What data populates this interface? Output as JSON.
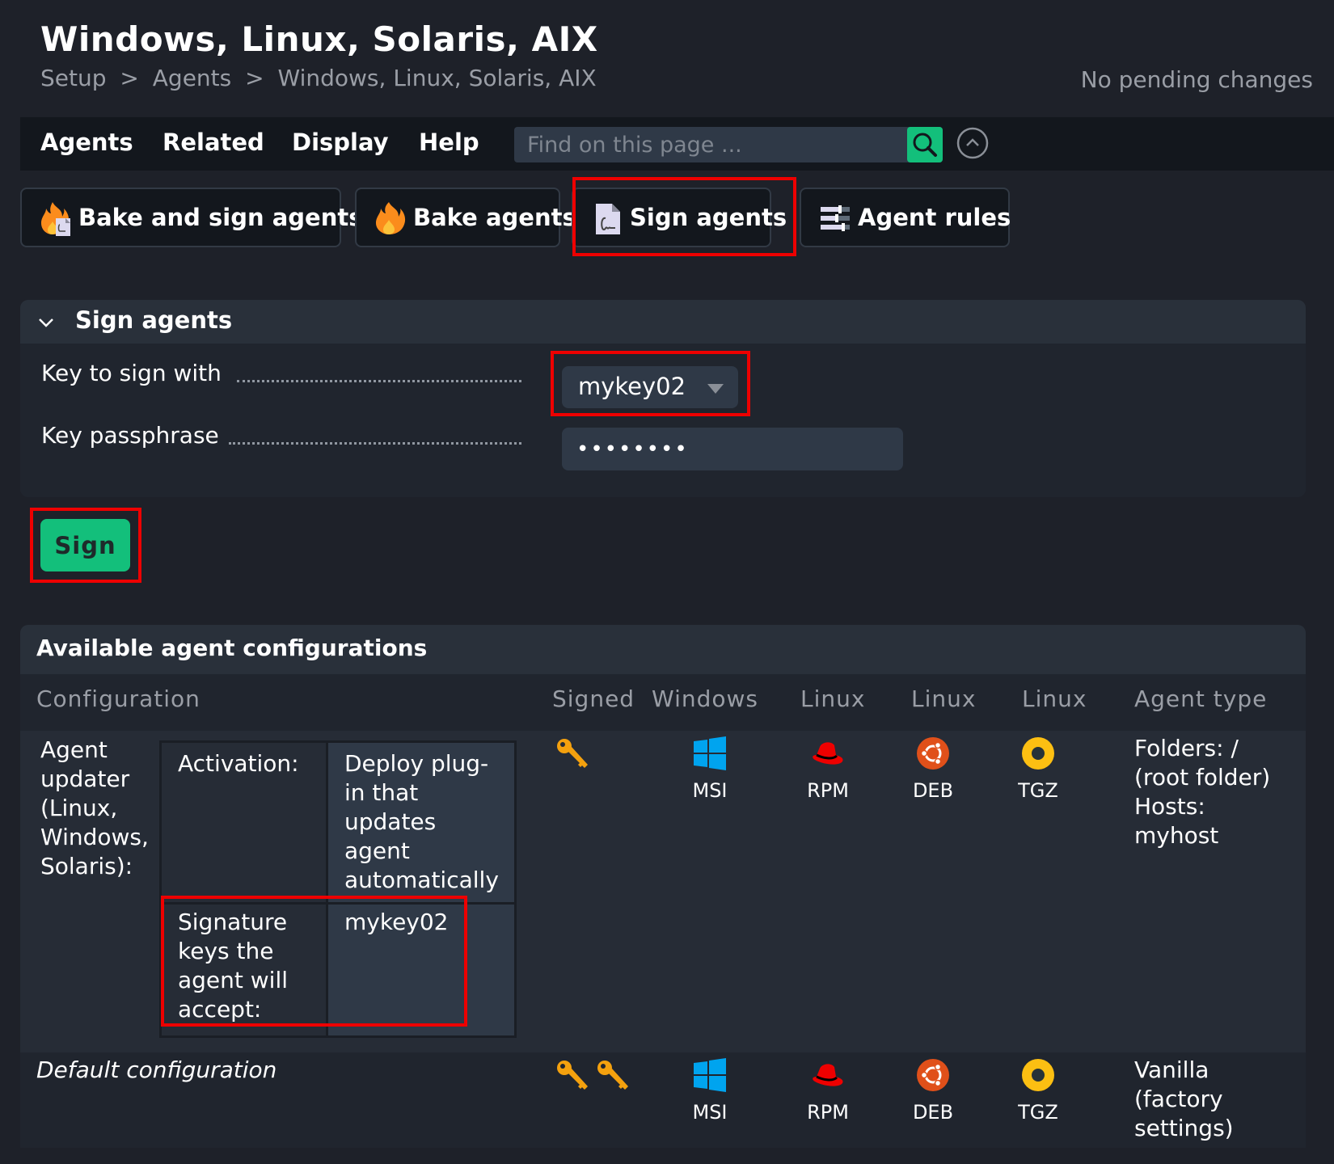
{
  "header": {
    "title": "Windows, Linux, Solaris, AIX",
    "breadcrumb": [
      "Setup",
      ">",
      "Agents",
      ">",
      "Windows, Linux, Solaris, AIX"
    ],
    "pending": "No pending changes"
  },
  "menubar": {
    "items": [
      "Agents",
      "Related",
      "Display",
      "Help"
    ],
    "search_placeholder": "Find on this page ...",
    "search_icon": "search-icon",
    "collapse_icon": "chevron-up-circle-icon"
  },
  "toolbar": {
    "buttons": [
      {
        "label": "Bake and sign agents",
        "icon": "flame-signature-icon"
      },
      {
        "label": "Bake agents",
        "icon": "flame-icon"
      },
      {
        "label": "Sign agents",
        "icon": "signed-document-icon"
      },
      {
        "label": "Agent rules",
        "icon": "rules-sliders-icon"
      }
    ]
  },
  "sign_panel": {
    "title": "Sign agents",
    "fields": {
      "key_label": "Key to sign with",
      "key_value": "mykey02",
      "passphrase_label": "Key passphrase",
      "passphrase_value": "********"
    },
    "sign_button": "Sign"
  },
  "configs": {
    "title": "Available agent configurations",
    "columns": [
      "Configuration",
      "Signed",
      "Windows",
      "Linux",
      "Linux",
      "Linux",
      "Agent type"
    ],
    "packages": [
      {
        "label": "MSI",
        "icon": "windows-icon"
      },
      {
        "label": "RPM",
        "icon": "redhat-icon"
      },
      {
        "label": "DEB",
        "icon": "ubuntu-icon"
      },
      {
        "label": "TGZ",
        "icon": "tgz-icon"
      }
    ],
    "rows": [
      {
        "name": "Agent updater (Linux, Windows, Solaris):",
        "details": [
          {
            "key": "Activation:",
            "value": "Deploy plug-in that updates agent automatically"
          },
          {
            "key": "Signature keys the agent will accept:",
            "value": "mykey02"
          }
        ],
        "signed_keys": 1,
        "agent_type": "Folders: / (root folder) Hosts: myhost"
      },
      {
        "name": "Default configuration",
        "signed_keys": 2,
        "agent_type": "Vanilla (factory settings)"
      }
    ]
  },
  "colors": {
    "accent_green": "#13bf7b",
    "highlight_red": "#ee0000",
    "background": "#1e2129"
  }
}
